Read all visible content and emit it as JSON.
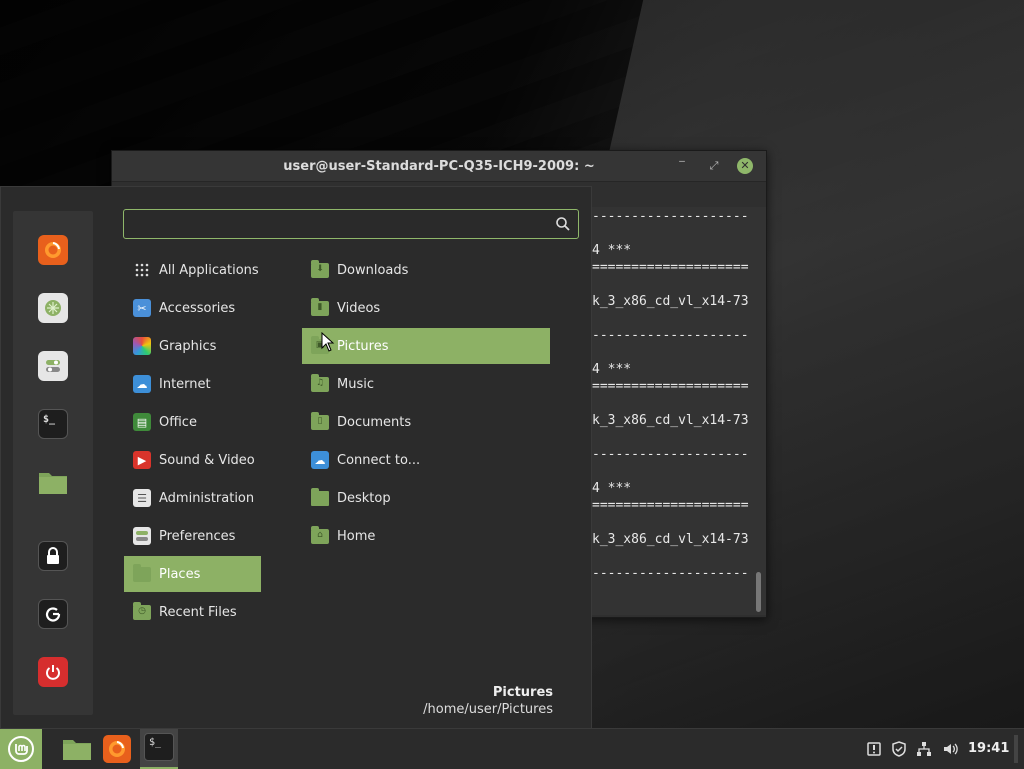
{
  "terminal": {
    "title": "user@user-Standard-PC-Q35-ICH9-2009: ~",
    "lines": [
      "--------------------",
      "4 ***",
      "====================",
      "k_3_x86_cd_vl_x14-73",
      "--------------------",
      "4 ***",
      "====================",
      "k_3_x86_cd_vl_x14-73",
      "--------------------",
      "4 ***",
      "====================",
      "k_3_x86_cd_vl_x14-73",
      "--------------------"
    ]
  },
  "menu": {
    "search": {
      "value": "",
      "placeholder": ""
    },
    "favorites": [
      {
        "name": "firefox-icon",
        "color": "#e66000"
      },
      {
        "name": "software-manager-icon",
        "color": "#e0e0e0"
      },
      {
        "name": "system-settings-icon",
        "color": "#e0e0e0"
      },
      {
        "name": "terminal-icon",
        "color": "#1e1e1e"
      },
      {
        "name": "files-icon",
        "color": "#7ea45a"
      },
      {
        "name": "lock-screen-icon",
        "color": "#1e1e1e"
      },
      {
        "name": "logout-icon",
        "color": "#1e1e1e"
      },
      {
        "name": "shutdown-icon",
        "color": "#d62e2e"
      }
    ],
    "categories": [
      {
        "label": "All Applications",
        "icon": "grid-icon"
      },
      {
        "label": "Accessories",
        "icon": "accessories-icon"
      },
      {
        "label": "Graphics",
        "icon": "graphics-icon"
      },
      {
        "label": "Internet",
        "icon": "internet-icon"
      },
      {
        "label": "Office",
        "icon": "office-icon"
      },
      {
        "label": "Sound & Video",
        "icon": "sound-video-icon"
      },
      {
        "label": "Administration",
        "icon": "administration-icon"
      },
      {
        "label": "Preferences",
        "icon": "preferences-icon"
      },
      {
        "label": "Places",
        "icon": "folder-icon",
        "selected": true
      },
      {
        "label": "Recent Files",
        "icon": "recent-files-icon"
      }
    ],
    "places": [
      {
        "label": "Downloads",
        "icon": "downloads-folder-icon"
      },
      {
        "label": "Videos",
        "icon": "videos-folder-icon"
      },
      {
        "label": "Pictures",
        "icon": "pictures-folder-icon",
        "selected": true
      },
      {
        "label": "Music",
        "icon": "music-folder-icon"
      },
      {
        "label": "Documents",
        "icon": "documents-folder-icon"
      },
      {
        "label": "Connect to...",
        "icon": "network-icon"
      },
      {
        "label": "Desktop",
        "icon": "desktop-folder-icon"
      },
      {
        "label": "Home",
        "icon": "home-folder-icon"
      }
    ],
    "info": {
      "name": "Pictures",
      "path": "/home/user/Pictures"
    }
  },
  "taskbar": {
    "clock": "19:41",
    "accent": "#8db165"
  }
}
